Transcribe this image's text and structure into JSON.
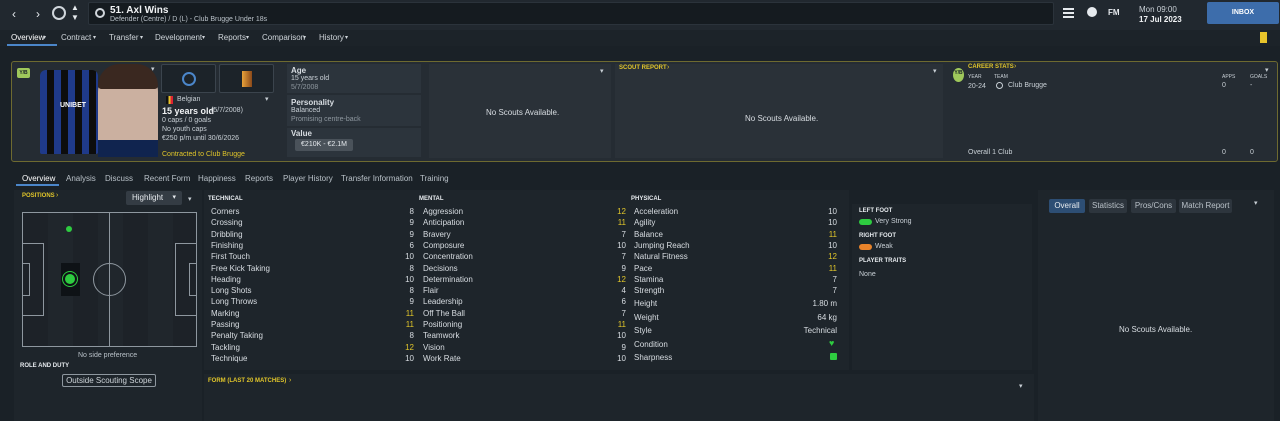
{
  "header": {
    "title": "51. Axl Wins",
    "subtitle": "Defender (Centre) / D (L) - Club Brugge Under 18s",
    "fm_logo": "FM",
    "time": "Mon 09:00",
    "date": "17 Jul 2023",
    "inbox_label": "INBOX"
  },
  "menu": [
    "Overview",
    "Contract",
    "Transfer",
    "Development",
    "Reports",
    "Comparison",
    "History"
  ],
  "card": {
    "kit_text": "UNIBET",
    "badge": "Y/B",
    "nationality": "Belgian",
    "age_line": "15 years old",
    "dob_inline": "(5/7/2008)",
    "caps": "0 caps / 0 goals",
    "youth_caps": "No youth caps",
    "wage": "€250 p/m until 30/6/2026",
    "contract": "Contracted to Club Brugge",
    "age_label": "Age",
    "age_value": "15 years old",
    "age_dob": "5/7/2008",
    "personality_label": "Personality",
    "personality_value": "Balanced",
    "personality_sub": "Promising centre-back",
    "value_label": "Value",
    "value_range": "€210K - €2.1M",
    "no_scouts_1": "No Scouts Available.",
    "scout_report_title": "SCOUT REPORT",
    "no_scouts_2": "No Scouts Available."
  },
  "career": {
    "title": "CAREER STATS",
    "badge": "Y/B",
    "col_year": "YEAR",
    "col_team": "TEAM",
    "col_apps": "APPS",
    "col_goals": "GOALS",
    "row": {
      "year": "20-24",
      "team": "Club Brugge",
      "apps": "0",
      "goals": "-"
    },
    "overall": {
      "label": "Overall 1 Club",
      "apps": "0",
      "goals": "0"
    }
  },
  "subtabs": [
    "Overview",
    "Analysis",
    "Discuss",
    "Recent Form",
    "Happiness",
    "Reports",
    "Player History",
    "Transfer Information",
    "Training"
  ],
  "positions": {
    "title": "POSITIONS",
    "dropdown": "Highlight",
    "side_pref": "No side preference",
    "role_title": "ROLE AND DUTY",
    "scope_button": "Outside Scouting Scope"
  },
  "attributes": {
    "technical_title": "TECHNICAL",
    "mental_title": "MENTAL",
    "physical_title": "PHYSICAL",
    "technical": [
      {
        "name": "Corners",
        "value": "8"
      },
      {
        "name": "Crossing",
        "value": "9"
      },
      {
        "name": "Dribbling",
        "value": "9"
      },
      {
        "name": "Finishing",
        "value": "6"
      },
      {
        "name": "First Touch",
        "value": "10"
      },
      {
        "name": "Free Kick Taking",
        "value": "8"
      },
      {
        "name": "Heading",
        "value": "10"
      },
      {
        "name": "Long Shots",
        "value": "8"
      },
      {
        "name": "Long Throws",
        "value": "9"
      },
      {
        "name": "Marking",
        "value": "11"
      },
      {
        "name": "Passing",
        "value": "11"
      },
      {
        "name": "Penalty Taking",
        "value": "8"
      },
      {
        "name": "Tackling",
        "value": "12"
      },
      {
        "name": "Technique",
        "value": "10"
      }
    ],
    "mental": [
      {
        "name": "Aggression",
        "value": "12"
      },
      {
        "name": "Anticipation",
        "value": "11"
      },
      {
        "name": "Bravery",
        "value": "7"
      },
      {
        "name": "Composure",
        "value": "10"
      },
      {
        "name": "Concentration",
        "value": "7"
      },
      {
        "name": "Decisions",
        "value": "9"
      },
      {
        "name": "Determination",
        "value": "12"
      },
      {
        "name": "Flair",
        "value": "4"
      },
      {
        "name": "Leadership",
        "value": "6"
      },
      {
        "name": "Off The Ball",
        "value": "7"
      },
      {
        "name": "Positioning",
        "value": "11"
      },
      {
        "name": "Teamwork",
        "value": "10"
      },
      {
        "name": "Vision",
        "value": "9"
      },
      {
        "name": "Work Rate",
        "value": "10"
      }
    ],
    "physical": [
      {
        "name": "Acceleration",
        "value": "10"
      },
      {
        "name": "Agility",
        "value": "10"
      },
      {
        "name": "Balance",
        "value": "11"
      },
      {
        "name": "Jumping Reach",
        "value": "10"
      },
      {
        "name": "Natural Fitness",
        "value": "12"
      },
      {
        "name": "Pace",
        "value": "11"
      },
      {
        "name": "Stamina",
        "value": "7"
      },
      {
        "name": "Strength",
        "value": "7"
      }
    ],
    "details": [
      {
        "name": "Height",
        "value": "1.80 m"
      },
      {
        "name": "Weight",
        "value": "64 kg"
      },
      {
        "name": "Style",
        "value": "Technical"
      },
      {
        "name": "Condition",
        "value": ""
      },
      {
        "name": "Sharpness",
        "value": ""
      }
    ]
  },
  "feet": {
    "left_title": "LEFT FOOT",
    "left_value": "Very Strong",
    "right_title": "RIGHT FOOT",
    "right_value": "Weak",
    "traits_title": "PLAYER TRAITS",
    "traits_value": "None"
  },
  "form_title": "FORM (LAST 20 MATCHES)",
  "right_panel": {
    "tabs": [
      "Overall",
      "Statistics",
      "Pros/Cons",
      "Match Report"
    ],
    "no_scouts": "No Scouts Available."
  },
  "colors": {
    "accent": "#4b86c9",
    "highlight": "#e0c52a",
    "good": "#2ecc40",
    "inbox": "#3d6dab"
  }
}
